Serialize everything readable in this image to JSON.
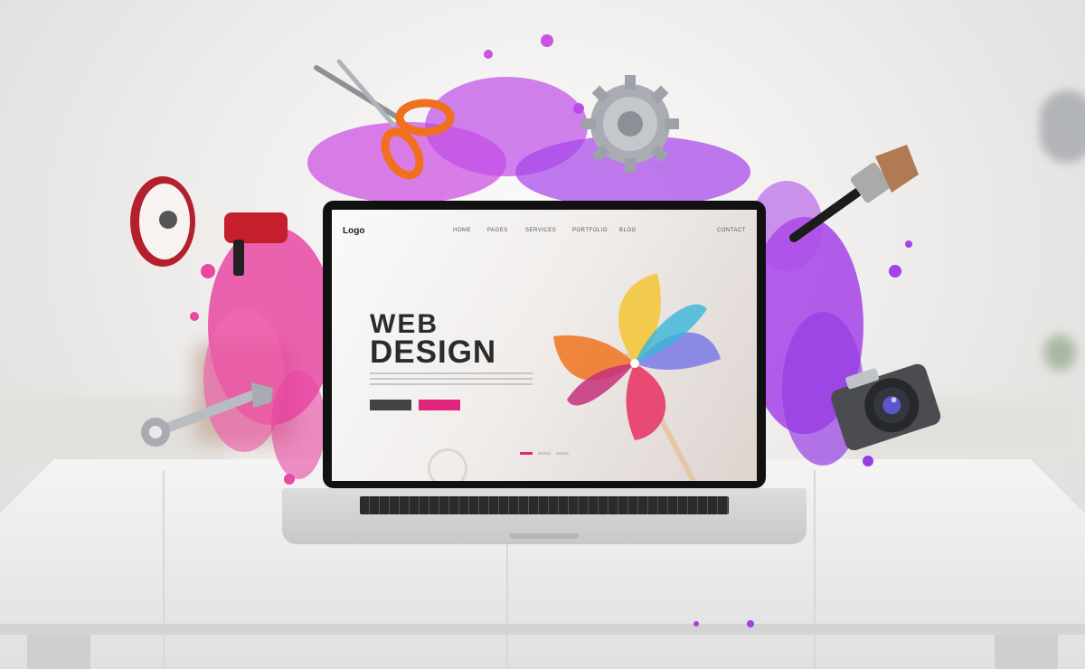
{
  "scene": {
    "website": {
      "logo": "Logo",
      "nav_links": [
        "HOME",
        "PAGES",
        "SERVICES",
        "PORTFOLIO",
        "BLOG"
      ],
      "contact_link": "CONTACT",
      "headline_line1": "WEB",
      "headline_line2": "DESIGN"
    },
    "objects": [
      "megaphone-icon",
      "scissors-icon",
      "gear-icon",
      "paintbrush-icon",
      "wrench-icon",
      "camera-icon",
      "pinwheel-icon"
    ],
    "colors": {
      "splash_magenta": "#e8359a",
      "splash_purple": "#9b2ee8",
      "accent_button": "#e0257a",
      "laptop_bezel": "#111111"
    }
  }
}
